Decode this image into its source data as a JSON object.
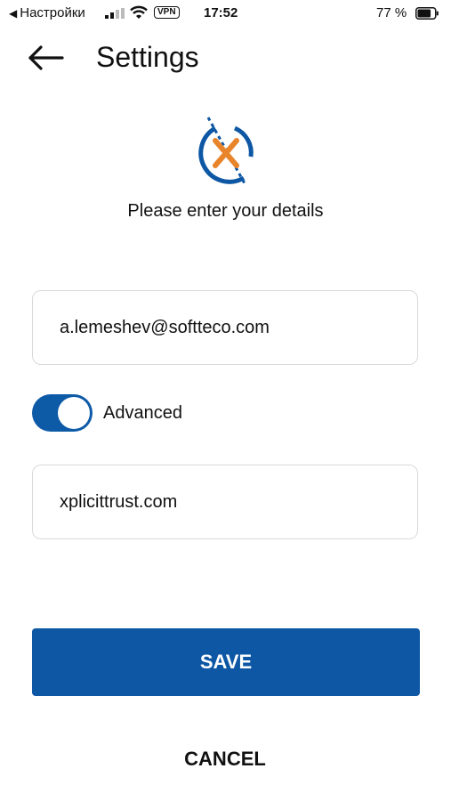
{
  "status_bar": {
    "back_app": "Настройки",
    "vpn": "VPN",
    "time": "17:52",
    "battery_percent": "77 %",
    "battery_level": 0.77
  },
  "header": {
    "title": "Settings",
    "back_icon": "arrow-left-icon"
  },
  "logo": {
    "icon": "xplicittrust-logo",
    "colors": {
      "ring": "#0d57a4",
      "x": "#e8852a"
    }
  },
  "subtitle": "Please enter your details",
  "form": {
    "email_value": "a.lemeshev@softteco.com",
    "advanced_label": "Advanced",
    "advanced_on": true,
    "server_value": "xplicittrust.com"
  },
  "actions": {
    "save_label": "SAVE",
    "cancel_label": "CANCEL"
  },
  "colors": {
    "accent": "#0d57a4",
    "logo_orange": "#e8852a"
  }
}
